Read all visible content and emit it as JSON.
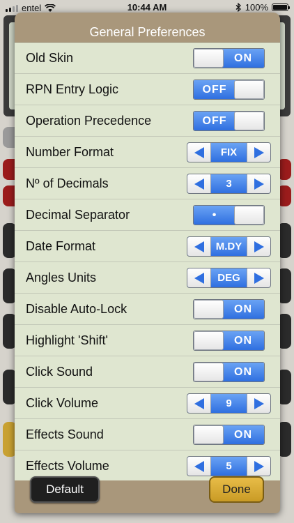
{
  "status_bar": {
    "carrier": "entel",
    "time": "10:44 AM",
    "battery": "100%"
  },
  "dialog": {
    "title": "General Preferences",
    "rows": [
      {
        "label": "Old Skin",
        "control": "toggle",
        "value": "ON"
      },
      {
        "label": "RPN Entry Logic",
        "control": "toggle",
        "value": "OFF"
      },
      {
        "label": "Operation Precedence",
        "control": "toggle",
        "value": "OFF"
      },
      {
        "label": "Number Format",
        "control": "stepper",
        "value": "FIX"
      },
      {
        "label": "Nº of Decimals",
        "control": "stepper",
        "value": "3"
      },
      {
        "label": "Decimal Separator",
        "control": "toggle",
        "value": "•"
      },
      {
        "label": "Date Format",
        "control": "stepper",
        "value": "M.DY"
      },
      {
        "label": "Angles Units",
        "control": "stepper",
        "value": "DEG"
      },
      {
        "label": "Disable Auto-Lock",
        "control": "toggle",
        "value": "ON"
      },
      {
        "label": "Highlight 'Shift'",
        "control": "toggle",
        "value": "ON"
      },
      {
        "label": "Click Sound",
        "control": "toggle",
        "value": "ON"
      },
      {
        "label": "Click Volume",
        "control": "stepper",
        "value": "9"
      },
      {
        "label": "Effects Sound",
        "control": "toggle",
        "value": "ON"
      },
      {
        "label": "Effects Volume",
        "control": "stepper",
        "value": "5"
      }
    ],
    "buttons": {
      "default_label": "Default",
      "done_label": "Done"
    }
  }
}
